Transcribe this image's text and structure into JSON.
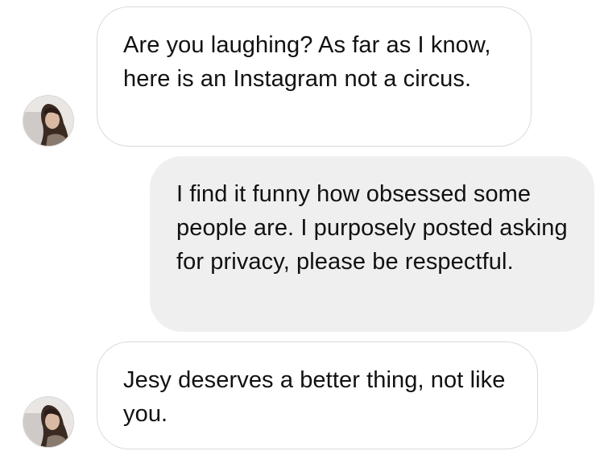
{
  "thread": {
    "messages": [
      {
        "sender": "other",
        "text": "Are you laughing? As far as I know, here is an Instagram not a circus."
      },
      {
        "sender": "self",
        "text": "I find it funny how obsessed some people are. I purposely posted asking for privacy, please be respectful."
      },
      {
        "sender": "other",
        "text": "Jesy deserves a better thing, not like you."
      }
    ]
  },
  "colors": {
    "incoming_bubble": "#ffffff",
    "incoming_border": "#dbdbdb",
    "outgoing_bubble": "#efefef",
    "text": "#111111"
  }
}
